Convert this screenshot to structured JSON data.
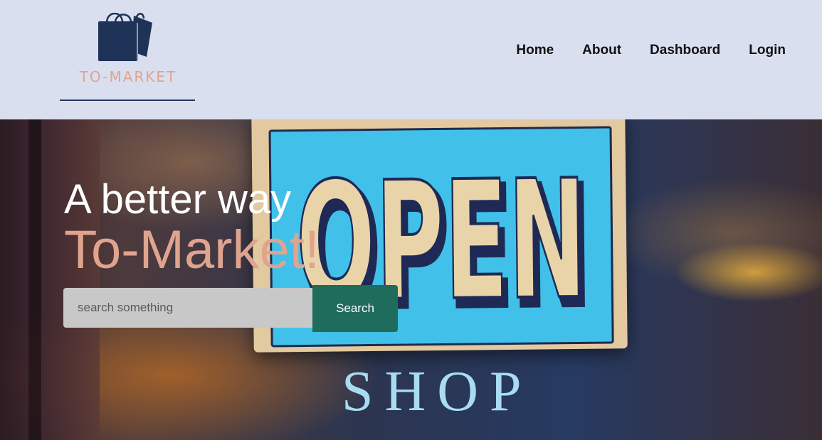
{
  "brand": {
    "name": "TO-MARKET"
  },
  "nav": {
    "items": [
      {
        "label": "Home"
      },
      {
        "label": "About"
      },
      {
        "label": "Dashboard"
      },
      {
        "label": "Login"
      }
    ]
  },
  "hero": {
    "headline": "A better way",
    "subheadline": "To-Market!",
    "sign_word": "OPEN",
    "shop_word": "SHOP"
  },
  "search": {
    "placeholder": "search something",
    "value": "",
    "button_label": "Search"
  },
  "colors": {
    "header_bg": "#dadff0",
    "accent_salmon": "#e0a48e",
    "brand_navy": "#22365c",
    "search_button": "#1f6b5c",
    "sign_blue": "#41c1e9"
  },
  "icons": {
    "logo": "shopping-bags-icon"
  }
}
